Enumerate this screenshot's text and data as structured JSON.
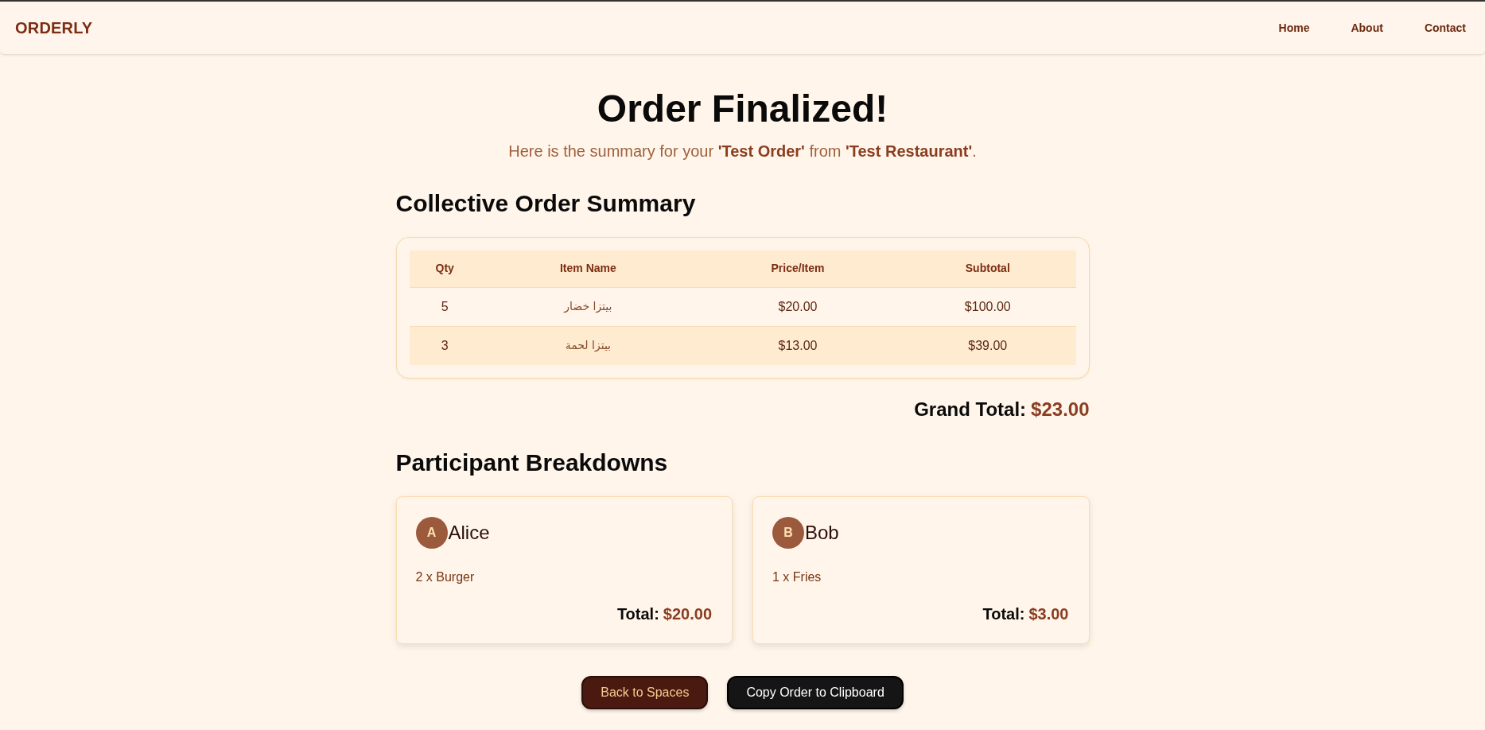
{
  "header": {
    "logo": "ORDERLY",
    "nav": [
      {
        "label": "Home"
      },
      {
        "label": "About"
      },
      {
        "label": "Contact"
      }
    ]
  },
  "title": "Order Finalized!",
  "subtitle": "Here is the summary for your **'Test Order'** from **'Test Restaurant'**.",
  "summary": {
    "heading": "Collective Order Summary",
    "table": {
      "columns": [
        "Qty",
        "Item Name",
        "Price/Item",
        "Subtotal"
      ],
      "rows": [
        [
          "5",
          "بيتزا خضار",
          "$20.00",
          "$100.00"
        ],
        [
          "3",
          "بيتزا لحمة",
          "$13.00",
          "$39.00"
        ]
      ]
    },
    "grand_total": {
      "label": "Grand Total:",
      "amount": "$23.00"
    }
  },
  "participants": {
    "heading": "Participant Breakdowns",
    "cards": [
      {
        "initial": "A",
        "name": "Alice",
        "items": [
          "2 x Burger"
        ],
        "total_label": "Total:",
        "total": "$20.00"
      },
      {
        "initial": "B",
        "name": "Bob",
        "items": [
          "1 x Fries"
        ],
        "total_label": "Total:",
        "total": "$3.00"
      }
    ]
  },
  "buttons": [
    {
      "label": "Back to Spaces",
      "kind": "secondary"
    },
    {
      "label": "Copy Order to Clipboard",
      "kind": "primary"
    }
  ]
}
